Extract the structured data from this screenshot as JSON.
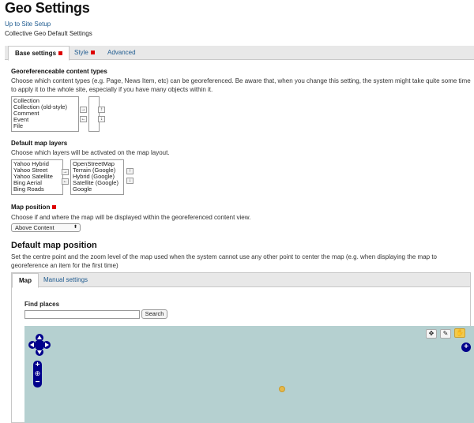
{
  "header": {
    "title": "Geo Settings",
    "up_link": "Up to Site Setup",
    "subtitle": "Collective Geo Default Settings"
  },
  "tabs": [
    {
      "label": "Base settings",
      "required": true
    },
    {
      "label": "Style",
      "required": true
    },
    {
      "label": "Advanced",
      "required": false
    }
  ],
  "content_types": {
    "heading": "Georeferenceable content types",
    "help": "Choose which content types (e.g. Page, News Item, etc) can be georeferenced. Be aware that, when you change this setting, the system might take quite some time to apply it to the whole site, especially if you have many objects within it.",
    "available": [
      "Collection",
      "Collection (old-style)",
      "Comment",
      "Event",
      "File"
    ],
    "selected": []
  },
  "map_layers": {
    "heading": "Default map layers",
    "help": "Choose which layers will be activated on the map layout.",
    "available": [
      "Yahoo Hybrid",
      "Yahoo Street",
      "Yahoo Satellite",
      "Bing Aerial",
      "Bing Roads"
    ],
    "selected": [
      "OpenStreetMap",
      "Terrain (Google)",
      "Hybrid (Google)",
      "Satellite (Google)",
      "Google"
    ]
  },
  "map_position": {
    "heading": "Map position",
    "help": "Choose if and where the map will be displayed within the georeferenced content view.",
    "value": "Above Content"
  },
  "default_map_position": {
    "heading": "Default map position",
    "help": "Set the centre point and the zoom level of the map used when the system cannot use any other point to center the map (e.g. when displaying the map to georeference an item for the first time)",
    "tabs": [
      "Map",
      "Manual settings"
    ],
    "find_label": "Find places",
    "search_value": "",
    "search_button": "Search"
  },
  "buttons": {
    "move_right": "→",
    "move_left": "←",
    "move_up": "↑",
    "move_down": "↓"
  },
  "map_controls": {
    "zoom_in": "+",
    "zoom_out": "−",
    "world": "⊕",
    "layer_switcher": "+"
  },
  "colors": {
    "link": "#205c90",
    "required": "#dd0000",
    "map_water": "#b5d0d0",
    "map_control": "#00008b",
    "marker": "#e6b84a"
  }
}
